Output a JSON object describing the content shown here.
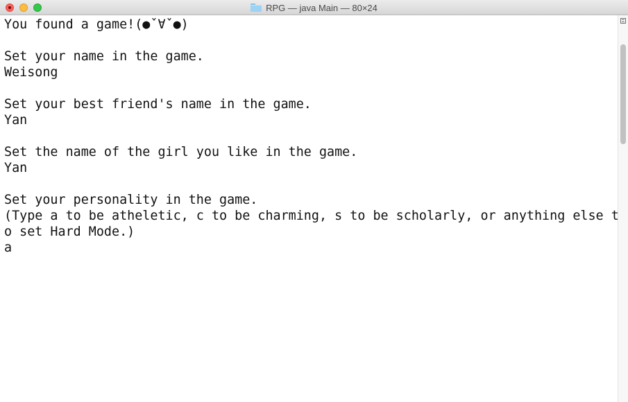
{
  "window": {
    "title": "RPG — java Main — 80×24",
    "folder_icon": "folder-icon",
    "controls": [
      "close-icon",
      "minimize-icon",
      "zoom-icon"
    ]
  },
  "terminal": {
    "lines": [
      "You found a game!(●ˇ∀ˇ●)",
      "",
      "Set your name in the game.",
      "Weisong",
      "",
      "Set your best friend's name in the game.",
      "Yan",
      "",
      "Set the name of the girl you like in the game.",
      "Yan",
      "",
      "Set your personality in the game.",
      "(Type a to be atheletic, c to be charming, s to be scholarly, or anything else t",
      "o set Hard Mode.)",
      "a"
    ]
  },
  "scrollbar": {
    "menu_icon": "scrollback-menu-icon"
  }
}
